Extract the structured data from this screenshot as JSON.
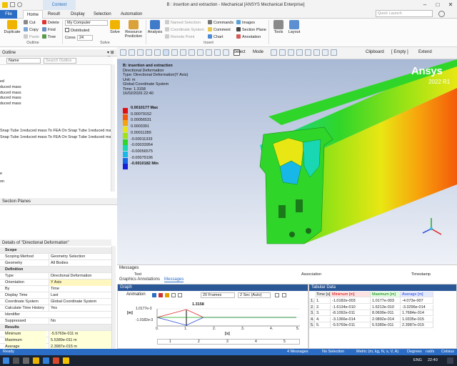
{
  "window": {
    "title": "B : insertion and extraction - Mechanical [ANSYS Mechanical Enterprise]",
    "context_tab": "Context"
  },
  "tabs": [
    "File",
    "Home",
    "Result",
    "Display",
    "Selection",
    "Automation"
  ],
  "quick_launch_placeholder": "Quick Launch",
  "ribbon": {
    "duplicate": "Duplicate",
    "cut": "Cut",
    "copy": "Copy",
    "paste": "Paste",
    "delete": "Delete",
    "find": "Find",
    "tree": "Tree",
    "outline_group": "Outline",
    "machine": "My Computer",
    "distributed": "Distributed",
    "cores_label": "Cores",
    "cores_value": "24",
    "solve": "Solve",
    "resource_prediction": "Resource Prediction",
    "solve_group": "Solve",
    "analysis": "Analysis",
    "named_selection": "Named Selection",
    "coordinate_system": "Coordinate System",
    "remote_point": "Remote Point",
    "commands": "Commands",
    "comment": "Comment",
    "chart": "Chart",
    "images": "Images",
    "section_plane": "Section Plane",
    "annotation": "Annotation",
    "insert_group": "Insert",
    "tools": "Tools",
    "layout": "Layout"
  },
  "graphics_toolbar": {
    "select": "Select",
    "mode": "Mode",
    "clipboard": "Clipboard",
    "empty": "[ Empty ]",
    "extend": "Extend"
  },
  "outline": {
    "title": "Outline",
    "name_label": "Name",
    "search_placeholder": "Search Outline",
    "lines": [
      "ed",
      "duced mass",
      "duced mass",
      "duced mass",
      "duced mass"
    ],
    "snap_lines": [
      "Snap Tube  1reduced mass To FEA On Snap Tube  1reduced mass",
      "Snap Tube  1reduced mass To FEA On Snap Tube  1reduced mass"
    ],
    "tail": [
      "e",
      "on"
    ]
  },
  "section_planes": {
    "title": "Section Planes"
  },
  "details": {
    "title": "Details of \"Directional Deformation\"",
    "rows": [
      {
        "k": "Scope",
        "v": "",
        "sec": true
      },
      {
        "k": "Scoping Method",
        "v": "Geometry Selection"
      },
      {
        "k": "Geometry",
        "v": "All Bodies"
      },
      {
        "k": "Definition",
        "v": "",
        "sec": true
      },
      {
        "k": "Type",
        "v": "Directional Deformation"
      },
      {
        "k": "Orientation",
        "v": "Y Axis",
        "hl": true
      },
      {
        "k": "By",
        "v": "Time"
      },
      {
        "k": "Display Time",
        "v": "Last"
      },
      {
        "k": "Coordinate System",
        "v": "Global Coordinate System"
      },
      {
        "k": "Calculate Time History",
        "v": "Yes"
      },
      {
        "k": "Identifier",
        "v": ""
      },
      {
        "k": "Suppressed",
        "v": "No"
      },
      {
        "k": "Results",
        "v": "",
        "sec": true
      },
      {
        "k": "Minimum",
        "v": "-5.5769e-011 m",
        "ro": true
      },
      {
        "k": "Maximum",
        "v": "5.5389e-011 m",
        "ro": true
      },
      {
        "k": "Average",
        "v": "2.3987e-015 m",
        "ro": true
      }
    ]
  },
  "legend": {
    "lines": [
      "B: insertion and extraction",
      "Directional Deformation",
      "Type: Directional Deformation(Y Axis)",
      "Unit: m",
      "Global Coordinate System",
      "Time: 1.3158",
      "16/02/2026 22:40"
    ],
    "bands": [
      {
        "label": "0.0010177 Max",
        "color": "#e01010"
      },
      {
        "label": "0.00079152",
        "color": "#f45a0a"
      },
      {
        "label": "0.00056531",
        "color": "#f7a20c"
      },
      {
        "label": "0.0003391",
        "color": "#e9e713"
      },
      {
        "label": "0.00011289",
        "color": "#9ee315"
      },
      {
        "label": "-0.00011333",
        "color": "#2fd629"
      },
      {
        "label": "-0.00033954",
        "color": "#18d7b2"
      },
      {
        "label": "-0.00056575",
        "color": "#17b8e8"
      },
      {
        "label": "-0.00079196",
        "color": "#1668e6"
      },
      {
        "label": "-0.0010182 Min",
        "color": "#1520d8"
      }
    ]
  },
  "brand": {
    "name": "Ansys",
    "version": "2022 R1"
  },
  "messages": {
    "title": "Messages",
    "cols": [
      "Text",
      "Association",
      "Timestamp"
    ],
    "tabs": [
      "Graphics Annotations",
      "Messages"
    ]
  },
  "graph": {
    "title": "Graph",
    "animation": "Animation",
    "frames": "20 Frames",
    "sec": "2 Sec (Auto)",
    "ymax": "1.0177e-3",
    "ymin": "-1.0182e-3",
    "ylabel": "[m]",
    "xlabel": "[s]",
    "marker": "1.3158",
    "xticks": [
      "0.",
      "1.",
      "2.",
      "3.",
      "4.",
      "5."
    ],
    "steps": [
      "1",
      "2",
      "3",
      "4",
      "5"
    ]
  },
  "tabular": {
    "title": "Tabular Data",
    "headers": [
      "Time [s]",
      "Minimum [m]",
      "Maximum [m]",
      "Average [m]"
    ],
    "rows": [
      [
        "1.",
        "1.",
        "-1.0182e-003",
        "1.0177e-003",
        "-4.073e-007"
      ],
      [
        "2.",
        "2.",
        "-1.6134e-010",
        "1.6213e-010",
        "-3.3296e-014"
      ],
      [
        "3.",
        "3.",
        "-8.1092e-011",
        "8.0699e-011",
        "1.7684e-014"
      ],
      [
        "4.",
        "4.",
        "-3.1366e-014",
        "2.0892e-014",
        "1.0335e-015"
      ],
      [
        "5.",
        "5.",
        "-5.5769e-011",
        "5.5389e-011",
        "2.3987e-015"
      ]
    ]
  },
  "status": {
    "ready": "Ready",
    "messages": "4 Messages",
    "selection": "No Selection",
    "units": "Metric (m, kg, N, s, V, A)",
    "degrees": "Degrees",
    "rads": "rad/s",
    "celsius": "Celsius"
  },
  "taskbar": {
    "lang": "ENG",
    "time": "22:40"
  }
}
